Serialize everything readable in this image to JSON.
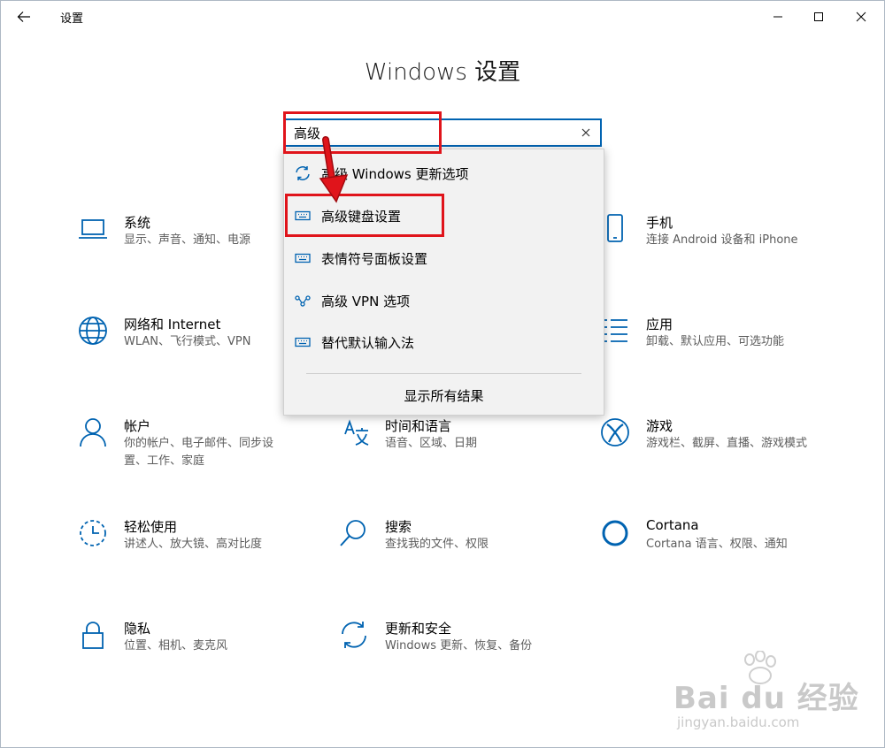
{
  "titlebar": {
    "title": "设置"
  },
  "page_title": "Windows 设置",
  "search": {
    "value": "高级",
    "placeholder": ""
  },
  "dropdown": {
    "items": [
      {
        "label": "高级 Windows 更新选项",
        "icon": "refresh-icon"
      },
      {
        "label": "高级键盘设置",
        "icon": "keyboard-icon"
      },
      {
        "label": "表情符号面板设置",
        "icon": "keyboard-icon"
      },
      {
        "label": "高级 VPN 选项",
        "icon": "vpn-icon"
      },
      {
        "label": "替代默认输入法",
        "icon": "keyboard-icon"
      }
    ],
    "show_all": "显示所有结果"
  },
  "tiles": [
    {
      "title": "系统",
      "desc": "显示、声音、通知、电源",
      "icon": "laptop-icon"
    },
    {
      "title": "手机",
      "desc": "连接 Android 设备和 iPhone",
      "icon": "phone-icon"
    },
    {
      "title": "网络和 Internet",
      "desc": "WLAN、飞行模式、VPN",
      "icon": "globe-icon"
    },
    {
      "title": "应用",
      "desc": "卸载、默认应用、可选功能",
      "icon": "apps-icon"
    },
    {
      "title": "帐户",
      "desc": "你的帐户、电子邮件、同步设置、工作、家庭",
      "icon": "person-icon"
    },
    {
      "title": "时间和语言",
      "desc": "语音、区域、日期",
      "icon": "time-language-icon"
    },
    {
      "title": "游戏",
      "desc": "游戏栏、截屏、直播、游戏模式",
      "icon": "xbox-icon"
    },
    {
      "title": "轻松使用",
      "desc": "讲述人、放大镜、高对比度",
      "icon": "ease-of-access-icon"
    },
    {
      "title": "搜索",
      "desc": "查找我的文件、权限",
      "icon": "search-icon"
    },
    {
      "title": "Cortana",
      "desc": "Cortana 语言、权限、通知",
      "icon": "cortana-icon"
    },
    {
      "title": "隐私",
      "desc": "位置、相机、麦克风",
      "icon": "lock-icon"
    },
    {
      "title": "更新和安全",
      "desc": "Windows 更新、恢复、备份",
      "icon": "update-icon"
    }
  ],
  "watermark": {
    "brand": "Bai du 经验",
    "url": "jingyan.baidu.com"
  },
  "colors": {
    "accent": "#0063b1",
    "annotation": "#e0141b"
  }
}
